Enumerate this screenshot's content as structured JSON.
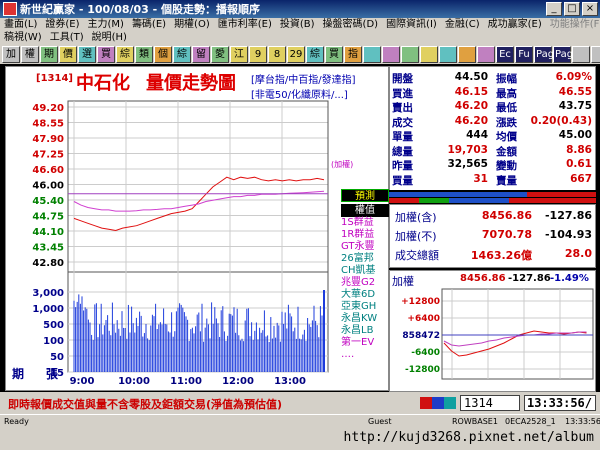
{
  "window": {
    "title": "新世紀贏家 - 100/08/03 - 個股走勢：播報順序",
    "buttons": [
      "_",
      "□",
      "×"
    ]
  },
  "menu1": [
    "畫面(L)",
    "證券(E)",
    "主力(M)",
    "籌碼(E)",
    "期權(O)",
    "匯市利率(E)",
    "投資(B)",
    "操盤密碼(D)",
    "國際資訊(I)",
    "金融(C)",
    "成功贏家(E)",
    "功能操作(F)"
  ],
  "menu2": [
    "稿視(W)",
    "工具(T)",
    "說明(H)"
  ],
  "toolbar": [
    "加",
    "權",
    "期",
    "價",
    "選",
    "買",
    "綜",
    "類",
    "個",
    "綜",
    "留",
    "愛",
    "江",
    "9",
    "8",
    "29",
    "綜",
    "買",
    "指",
    "",
    "",
    "",
    "",
    "",
    "",
    "",
    "Ec",
    "Fu",
    "Page",
    "Page",
    "",
    "",
    ""
  ],
  "chart": {
    "code": "[1314]",
    "stock_name": "中石化",
    "title": "量價走勢圖",
    "index_line1": "[摩台指/中百指/發達指]",
    "index_line2": "[非電50/化纖原料/...]",
    "price_ticks": [
      "49.20",
      "48.55",
      "47.90",
      "47.25",
      "46.60",
      "46.00",
      "45.40",
      "44.75",
      "44.10",
      "43.45",
      "42.80"
    ],
    "volume_ticks": [
      "3,000",
      "1,000",
      "500",
      "100",
      "50",
      "15"
    ],
    "volume_label_left": "期",
    "volume_label_right": "張",
    "time_ticks": [
      "9:00",
      "10:00",
      "11:00",
      "12:00",
      "13:00"
    ],
    "ref_label": "(加權)"
  },
  "legend": {
    "yuce": "預測",
    "quanzhi": "權值",
    "items": [
      {
        "label": "1S群益",
        "color": "#c000c0"
      },
      {
        "label": "1R群益",
        "color": "#c000c0"
      },
      {
        "label": "GT永豐",
        "color": "#c000c0"
      },
      {
        "label": "26富邦",
        "color": "#008080"
      },
      {
        "label": "CH凱基",
        "color": "#008080"
      },
      {
        "label": "兆豐G2",
        "color": "#c000c0"
      },
      {
        "label": "大華6D",
        "color": "#008080"
      },
      {
        "label": "亞東GH",
        "color": "#008080"
      },
      {
        "label": "永昌KW",
        "color": "#008080"
      },
      {
        "label": "永昌LB",
        "color": "#008080"
      },
      {
        "label": "第一EV",
        "color": "#c000c0"
      },
      {
        "label": "‥‥",
        "color": "#c000c0"
      }
    ]
  },
  "quote": {
    "rows": [
      {
        "l1": "開盤",
        "v1": "44.50",
        "c1": "#000000",
        "l2": "振幅",
        "v2": "6.09%",
        "c2": "#d00000"
      },
      {
        "l1": "買進",
        "v1": "46.15",
        "c1": "#d00000",
        "l2": "最高",
        "v2": "46.55",
        "c2": "#d00000"
      },
      {
        "l1": "賣出",
        "v1": "46.20",
        "c1": "#d00000",
        "l2": "最低",
        "v2": "43.75",
        "c2": "#000000"
      },
      {
        "l1": "成交",
        "v1": "46.20",
        "c1": "#d00000",
        "l2": "漲跌",
        "v2": "0.20(0.43)",
        "c2": "#d00000"
      },
      {
        "l1": "單量",
        "v1": "444",
        "c1": "#000000",
        "l2": "均價",
        "v2": "45.00",
        "c2": "#000000"
      },
      {
        "l1": "總量",
        "v1": "19,703",
        "c1": "#d00000",
        "l2": "金額",
        "v2": "8.86",
        "c2": "#d00000"
      },
      {
        "l1": "昨量",
        "v1": "32,565",
        "c1": "#000000",
        "l2": "變動",
        "v2": "0.61",
        "c2": "#d00000"
      },
      {
        "l1": "買量",
        "v1": "31",
        "c1": "#d00000",
        "l2": "賣量",
        "v2": "667",
        "c2": "#d00000"
      }
    ]
  },
  "index": {
    "rows": [
      {
        "label": "加權(含)",
        "v1": "8456.86",
        "v2": "-127.86"
      },
      {
        "label": "加權(不)",
        "v1": "7070.78",
        "v2": "-104.93"
      },
      {
        "label": "成交總額",
        "v1": "1463.26億",
        "v2": "28.0"
      }
    ]
  },
  "mini": {
    "title": "加權",
    "v1": "8456.86",
    "v2": "-127.86",
    "v3": "-1.49%",
    "ticks": [
      "+12800",
      "+6400",
      "858472",
      "-6400",
      "-12800"
    ]
  },
  "bottom": {
    "disclaimer": "即時報價成交值與量不含零股及鉅額交易(淨值為預估值)",
    "code_input": "1314",
    "clock": "13:33:56/"
  },
  "statusbar": {
    "ready": "Ready",
    "guest": "Guest",
    "row": "ROWBASE1",
    "seca": "0ECA2528_1",
    "time": "13:33:56"
  },
  "watermark": "http://kujd3268.pixnet.net/album",
  "series": {
    "price": [
      44.6,
      44.5,
      44.4,
      44.3,
      44.2,
      44.15,
      44.1,
      44.2,
      44.25,
      44.3,
      44.4,
      44.5,
      44.6,
      44.7,
      44.8,
      44.85,
      44.9,
      45.0,
      45.3,
      45.6,
      45.9,
      46.1,
      46.3,
      46.2,
      46.3,
      46.25,
      46.3,
      46.2,
      46.15,
      46.2,
      46.15,
      46.2,
      46.15,
      46.2,
      46.2,
      46.25,
      46.2
    ],
    "avg": [
      45.3,
      45.15,
      45.05,
      45.0,
      44.95,
      44.95,
      44.9,
      44.9,
      44.9,
      44.92,
      44.95,
      44.95,
      44.97,
      45.0,
      45.0,
      45.05,
      45.1,
      45.15,
      45.2,
      45.3,
      45.35,
      45.4,
      45.45,
      45.5,
      45.5,
      45.55,
      45.55,
      45.6,
      45.6,
      45.6,
      45.62,
      45.64,
      45.65,
      45.66,
      45.68,
      45.7,
      45.72
    ],
    "price_min": 42.8,
    "price_max": 49.2
  }
}
